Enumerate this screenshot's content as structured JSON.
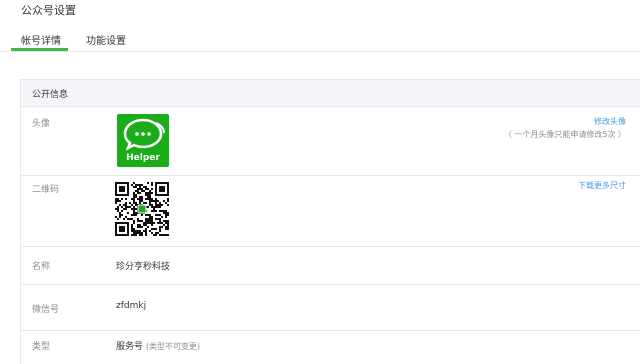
{
  "header": {
    "title": "公众号设置"
  },
  "tabs": [
    {
      "label": "帐号详情",
      "active": true
    },
    {
      "label": "功能设置",
      "active": false
    }
  ],
  "panel": {
    "title": "公开信息",
    "rows": {
      "avatar": {
        "label": "头像",
        "image_text": "Helper",
        "action": "修改头像",
        "hint": "（ 一个月头像只能申请修改5次 ）"
      },
      "qrcode": {
        "label": "二维码",
        "action": "下载更多尺寸"
      },
      "name": {
        "label": "名称",
        "value": "珍分亨秒科技"
      },
      "wechat_id": {
        "label": "微信号",
        "value": "zfdmkj"
      },
      "type": {
        "label": "类型",
        "value": "服务号",
        "note": "(类型不可变更)"
      }
    }
  },
  "colors": {
    "accent": "#44b549",
    "link": "#459ae9",
    "avatar_bg": "#1aad19",
    "muted_text": "#8d8d8d",
    "border": "#e7e7eb",
    "panel_header_bg": "#f4f5f9"
  }
}
